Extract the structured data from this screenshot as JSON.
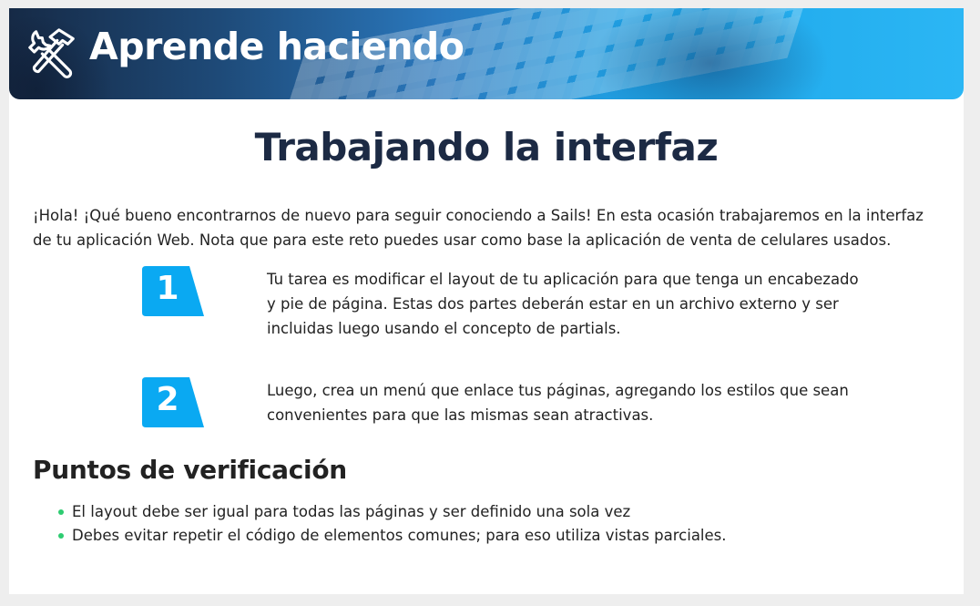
{
  "banner": {
    "title": "Aprende haciendo",
    "icon": "hammer-wrench-icon"
  },
  "content": {
    "title": "Trabajando la interfaz",
    "intro": "¡Hola! ¡Qué bueno encontrarnos de nuevo para seguir conociendo a Sails! En esta ocasión trabajaremos en la interfaz de tu aplicación Web. Nota que para este reto puedes usar como base la aplicación de venta de celulares usados.",
    "steps": [
      {
        "number": "1",
        "text": "Tu tarea es modificar el layout de tu aplicación para que tenga un encabezado y pie de página. Estas dos partes deberán estar en un archivo externo y ser incluidas luego usando el concepto de partials."
      },
      {
        "number": "2",
        "text": "Luego, crea un menú que enlace tus páginas, agregando los estilos que sean convenientes para que las mismas sean atractivas."
      }
    ],
    "checkpoints_title": "Puntos de verificación",
    "checkpoints": [
      "El layout debe ser igual para todas las páginas y ser definido una sola vez",
      "Debes evitar repetir el código de elementos comunes; para eso utiliza vistas parciales."
    ]
  },
  "colors": {
    "step_badge": "#0aa9f2",
    "bullet": "#2ecc71",
    "title": "#1c2a44",
    "banner_dark": "#162a46",
    "banner_light": "#2bb6f4"
  }
}
